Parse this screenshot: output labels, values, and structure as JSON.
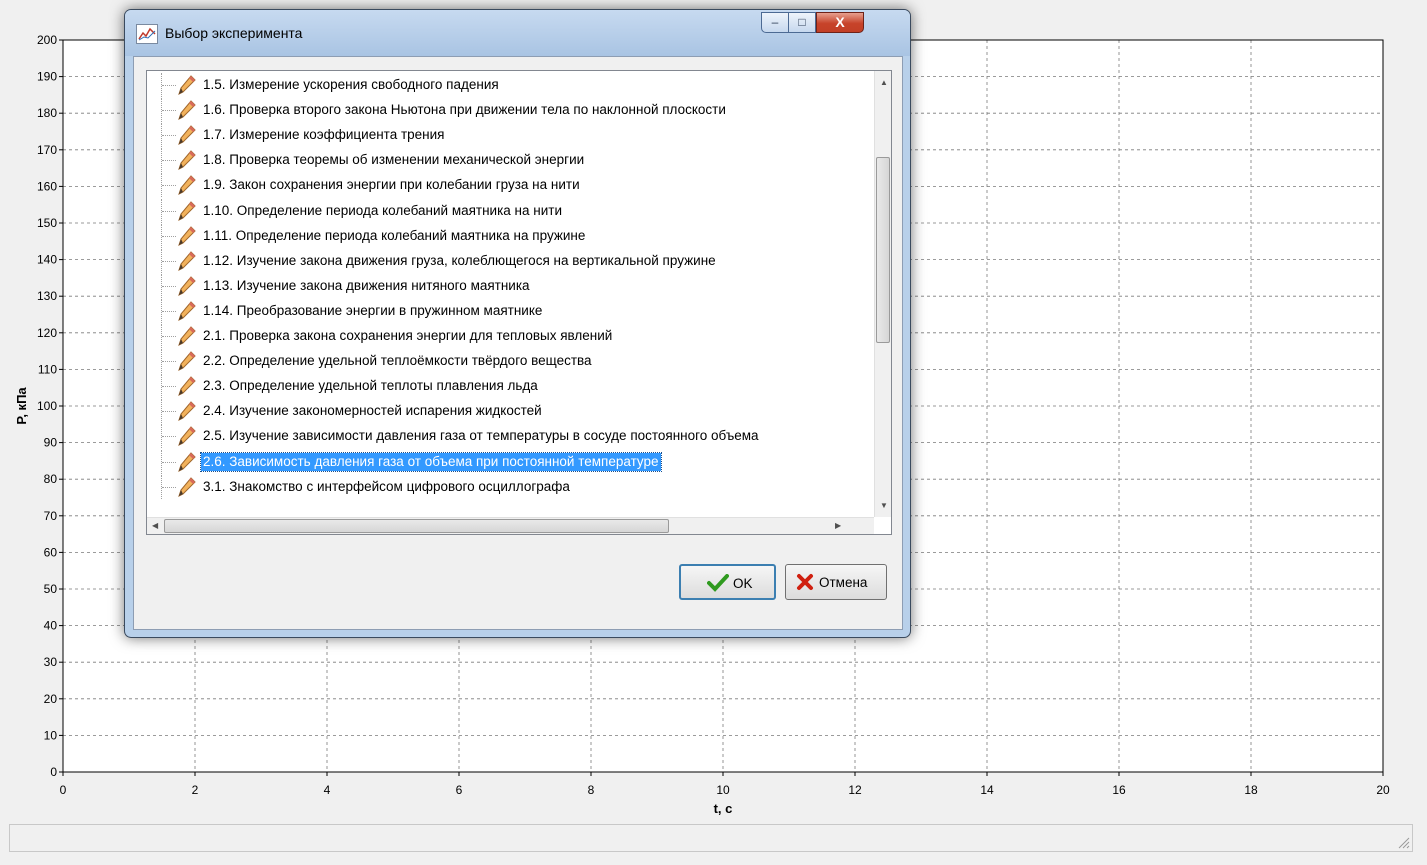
{
  "chart_data": {
    "type": "line",
    "xlabel": "t, c",
    "ylabel": "P, кПа",
    "xlim": [
      0,
      20
    ],
    "ylim": [
      0,
      200
    ],
    "x_ticks": [
      "0",
      "2",
      "4",
      "6",
      "8",
      "10",
      "12",
      "14",
      "16",
      "18",
      "20"
    ],
    "y_ticks": [
      "0",
      "10",
      "20",
      "30",
      "40",
      "50",
      "60",
      "70",
      "80",
      "90",
      "100",
      "110",
      "120",
      "130",
      "140",
      "150",
      "160",
      "170",
      "180",
      "190",
      "200"
    ],
    "grid": true,
    "series": []
  },
  "dialog": {
    "title": "Выбор эксперимента",
    "icons": {
      "app": "chart-icon",
      "item": "pencil-icon"
    },
    "caption_buttons": {
      "minimize": "–",
      "maximize": "□",
      "close": "X"
    },
    "items": [
      {
        "label": "1.5. Измерение ускорения свободного падения"
      },
      {
        "label": "1.6. Проверка второго закона Ньютона при движении тела по наклонной плоскости"
      },
      {
        "label": "1.7. Измерение коэффициента трения"
      },
      {
        "label": "1.8. Проверка теоремы об изменении механической энергии"
      },
      {
        "label": "1.9. Закон сохранения энергии при колебании груза на нити"
      },
      {
        "label": "1.10. Определение периода колебаний маятника на нити"
      },
      {
        "label": "1.11. Определение периода колебаний маятника на пружине"
      },
      {
        "label": "1.12. Изучение закона движения груза, колеблющегося на вертикальной пружине"
      },
      {
        "label": "1.13. Изучение закона движения нитяного маятника"
      },
      {
        "label": "1.14. Преобразование энергии в пружинном маятнике"
      },
      {
        "label": "2.1. Проверка закона сохранения энергии для тепловых явлений"
      },
      {
        "label": "2.2. Определение удельной теплоёмкости твёрдого вещества"
      },
      {
        "label": "2.3. Определение удельной теплоты плавления льда"
      },
      {
        "label": "2.4. Изучение закономерностей испарения жидкостей"
      },
      {
        "label": "2.5. Изучение зависимости давления газа от температуры в сосуде постоянного объема"
      },
      {
        "label": "2.6. Зависимость давления газа от объема при постоянной температуре",
        "selected": true
      },
      {
        "label": "3.1. Знакомство с интерфейсом цифрового осциллографа"
      }
    ],
    "ok_label": "OK",
    "cancel_label": "Отмена",
    "colors": {
      "selection": "#3399ff",
      "ok_check": "#2f9a1f",
      "cancel_x": "#d02010"
    }
  }
}
